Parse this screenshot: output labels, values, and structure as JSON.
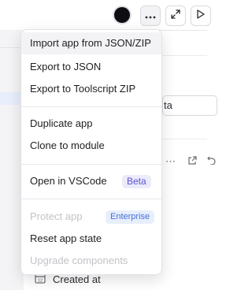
{
  "toolbar": {
    "more_icon": "more-horizontal-icon",
    "expand_icon": "expand-icon",
    "play_icon": "play-icon"
  },
  "background": {
    "input_value": "ta",
    "created_label": "Created at",
    "calendar_icon_text": "12"
  },
  "menu": {
    "import_label": "Import app from JSON/ZIP",
    "export_json_label": "Export to JSON",
    "export_zip_label": "Export to Toolscript ZIP",
    "duplicate_label": "Duplicate app",
    "clone_label": "Clone to module",
    "vscode_label": "Open in VSCode",
    "vscode_badge": "Beta",
    "protect_label": "Protect app",
    "protect_badge": "Enterprise",
    "reset_label": "Reset app state",
    "upgrade_label": "Upgrade components"
  },
  "colors": {
    "beta_badge_bg": "#ecebfb",
    "beta_badge_text": "#5b52d6",
    "enterprise_badge_bg": "#e7eefc",
    "enterprise_badge_text": "#4472d6",
    "disabled_text": "#c3c3c8"
  }
}
